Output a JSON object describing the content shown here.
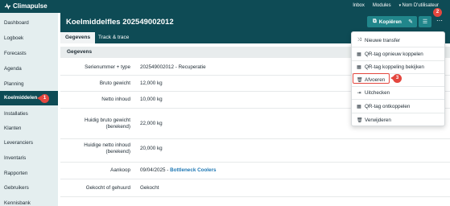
{
  "app": {
    "name": "Climapulse"
  },
  "topnav": {
    "inbox": "Inbox",
    "modules": "Modules",
    "user": "Nom D'utilisateur"
  },
  "sidebar": {
    "items": [
      {
        "label": "Dashboard"
      },
      {
        "label": "Logboek"
      },
      {
        "label": "Forecasts"
      },
      {
        "label": "Agenda"
      },
      {
        "label": "Planning"
      },
      {
        "label": "Koelmiddelen"
      },
      {
        "label": "Installaties"
      },
      {
        "label": "Klanten"
      },
      {
        "label": "Leveranciers"
      },
      {
        "label": "Inventaris"
      },
      {
        "label": "Rapporten"
      },
      {
        "label": "Gebruikers"
      },
      {
        "label": "Kennisbank"
      }
    ]
  },
  "header": {
    "title": "Koelmiddelfles 202549002012",
    "copy_label": "Kopiëren"
  },
  "tabs": [
    {
      "label": "Gegevens"
    },
    {
      "label": "Track & trace"
    }
  ],
  "section": {
    "title": "Gegevens"
  },
  "fields": [
    {
      "label": "Serienummer + type",
      "value": "202549002012 - Recuperatie"
    },
    {
      "label": "Bruto gewicht",
      "value": "12,000 kg"
    },
    {
      "label": "Netto inhoud",
      "value": "10,000 kg"
    },
    {
      "label": "Huidig bruto gewicht (berekend)",
      "value": "22,000 kg"
    },
    {
      "label": "Huidige netto inhoud (berekend)",
      "value": "20,000 kg"
    },
    {
      "label": "Aankoop",
      "value": "09/04/2025 -",
      "link": "Bottleneck Coolers"
    },
    {
      "label": "Gekocht of gehuurd",
      "value": "Gekocht"
    }
  ],
  "dropdown": {
    "items": [
      {
        "label": "Nieuwe transfer",
        "icon": "shuffle-icon"
      },
      {
        "label": "QR-tag opnieuw koppelen",
        "icon": "qr-icon"
      },
      {
        "label": "QR-tag koppeling bekijken",
        "icon": "qr-icon"
      },
      {
        "label": "Afvoeren",
        "icon": "trash-icon"
      },
      {
        "label": "Uitchecken",
        "icon": "checkout-icon"
      },
      {
        "label": "QR-tag ontkoppelen",
        "icon": "qr-icon"
      },
      {
        "label": "Verwijderen",
        "icon": "trash-icon"
      }
    ]
  },
  "badges": {
    "one": "1",
    "two": "2",
    "three": "3"
  },
  "colors": {
    "primary": "#0e4b55",
    "accent": "#21868b",
    "marker": "#e4473f",
    "link": "#1f78b4"
  }
}
